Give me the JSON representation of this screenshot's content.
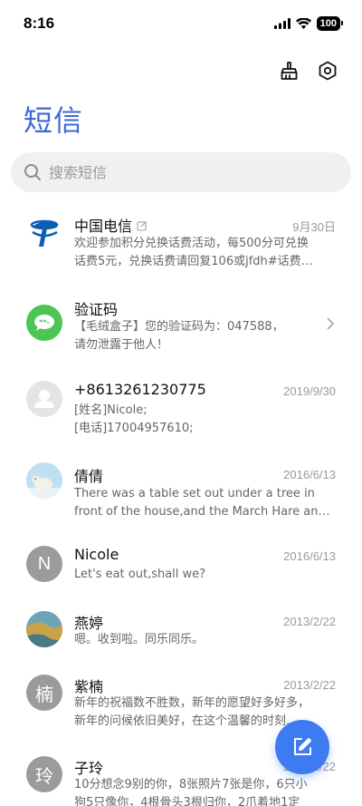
{
  "status": {
    "time": "8:16",
    "battery": "100"
  },
  "header": {
    "title": "短信"
  },
  "search": {
    "placeholder": "搜索短信"
  },
  "messages": [
    {
      "name": "中国电信",
      "date": "9月30日",
      "line1": "欢迎参加积分兑换话费活动，每500分可兑换",
      "line2": "话费5元，兑换话费请回复106或jfdh#话费…",
      "avatar": "telecom-logo-icon"
    },
    {
      "name": "验证码",
      "date": "",
      "line1": "【毛绒盒子】您的验证码为：047588，",
      "line2": "请勿泄露于他人！",
      "avatar": "verification-code-icon"
    },
    {
      "name": "+8613261230775",
      "date": "2019/9/30",
      "line1": "[姓名]Nicole;",
      "line2": "[电话]17004957610;",
      "avatar": "default-person-icon"
    },
    {
      "name": "倩倩",
      "date": "2016/6/13",
      "line1": "There was a table set out under a tree in",
      "line2": "front of the house,and the March Hare an…",
      "avatar": "polar-bear-photo"
    },
    {
      "name": "Nicole",
      "date": "2016/6/13",
      "line1": "Let's eat out,shall we?",
      "line2": "",
      "avatar_letter": "N"
    },
    {
      "name": "燕婷",
      "date": "2013/2/22",
      "line1": "嗯。收到啦。同乐同乐。",
      "line2": "",
      "avatar": "landscape-photo"
    },
    {
      "name": "紫楠",
      "date": "2013/2/22",
      "line1": "新年的祝福数不胜数，新年的愿望好多好多，",
      "line2": "新年的问候依旧美好，在这个温馨的时刻…",
      "avatar_letter": "楠"
    },
    {
      "name": "子玲",
      "date": "2013/2/22",
      "line1": "10分想念9别的你，8张照片7张是你，6只小",
      "line2": "狗5只像你，4根骨头3根归你，2爪着地1定",
      "avatar_letter": "玲"
    }
  ],
  "colors": {
    "accent": "#3f67d6",
    "fab": "#3d7bf2",
    "avatar_gray": "#9b9b9b",
    "verification_green": "#4cc552"
  }
}
